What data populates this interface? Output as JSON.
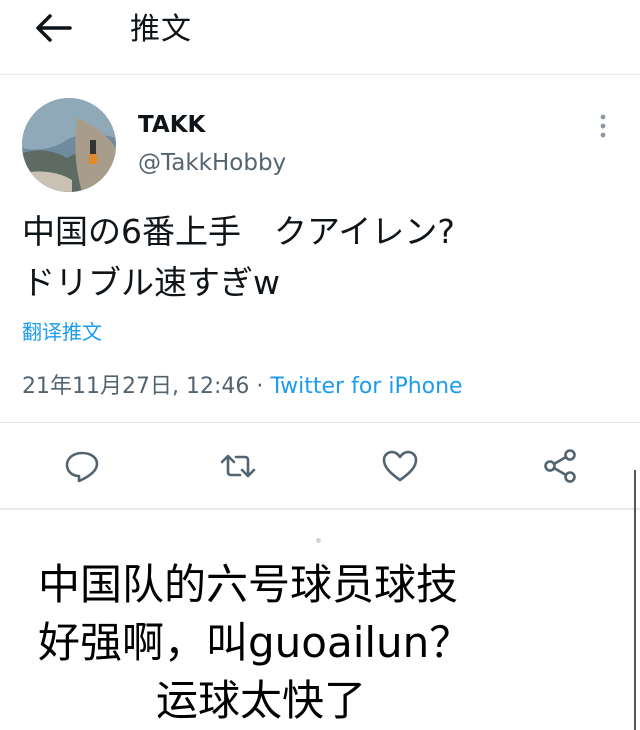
{
  "header": {
    "back_icon": "arrow-left-icon",
    "title": "推文"
  },
  "tweet": {
    "author_name": "TAKK",
    "author_handle": "@TakkHobby",
    "text_lines": [
      "中国の6番上手　クアイレン?",
      "ドリブル速すぎw"
    ],
    "translate_label": "翻译推文",
    "timestamp": "21年11月27日, 12:46",
    "separator": " · ",
    "source": "Twitter for iPhone"
  },
  "actions": [
    "reply-icon",
    "retweet-icon",
    "like-icon",
    "share-icon"
  ],
  "caption": {
    "lines": [
      "中国队的六号球员球技",
      "好强啊，叫guoailun？",
      "运球太快了"
    ]
  },
  "colors": {
    "link": "#1d9bf0",
    "secondary_text": "#536471",
    "primary_text": "#0f1419"
  }
}
